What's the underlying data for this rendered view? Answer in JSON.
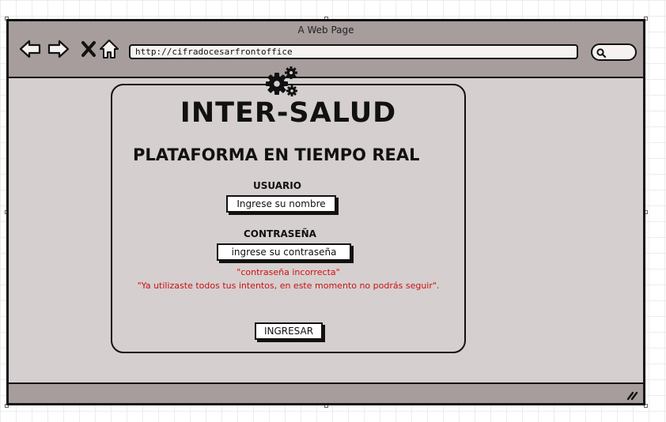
{
  "browser": {
    "title": "A Web Page",
    "url": "http://cifradocesarfrontoffice",
    "nav_icons": [
      "back-arrow-icon",
      "forward-arrow-icon",
      "close-x-icon",
      "home-icon"
    ],
    "search_icon": "search-icon",
    "resize_icon": "resize-grip-icon"
  },
  "login": {
    "logo_icon": "gears-icon",
    "app_title": "INTER-SALUD",
    "subtitle": "PLATAFORMA EN TIEMPO REAL",
    "username_label": "USUARIO",
    "username_placeholder": "Ingrese su nombre",
    "password_label": "CONTRASEÑA",
    "password_placeholder": "ingrese su contraseña",
    "error_line1": "\"contraseña incorrecta\"",
    "error_line2": "\"Ya utilizaste todos tus intentos, en este momento no podrás seguir\".",
    "submit_label": "INGRESAR"
  },
  "colors": {
    "window_bg": "#d6cfcf",
    "chrome_bg": "#a79d9d",
    "error": "#cc1111",
    "ink": "#111111"
  }
}
